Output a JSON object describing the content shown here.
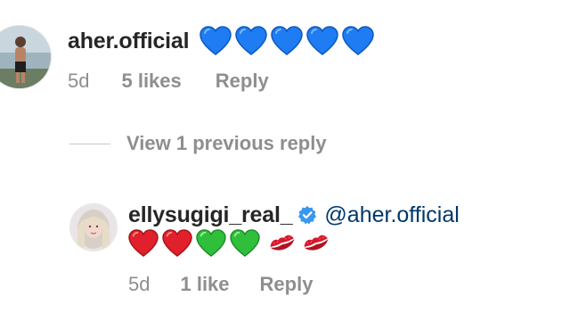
{
  "comments": [
    {
      "username": "aher.official",
      "text_emoji": [
        "blue-heart",
        "blue-heart",
        "blue-heart",
        "blue-heart",
        "blue-heart"
      ],
      "time": "5d",
      "likes": "5 likes",
      "reply_label": "Reply"
    }
  ],
  "thread": {
    "view_replies_label": "View 1 previous reply"
  },
  "reply": {
    "username": "ellysugigi_real_",
    "verified": true,
    "mention": "@aher.official",
    "text_emoji": [
      "red-heart",
      "red-heart",
      "green-heart",
      "green-heart",
      "kiss-mark",
      "kiss-mark"
    ],
    "time": "5d",
    "likes": "1 like",
    "reply_label": "Reply"
  },
  "colors": {
    "blue_heart": "#1f7cf2",
    "red_heart": "#e0202a",
    "green_heart": "#2fbf3a",
    "kiss_mark": "#d7192d",
    "verified_badge": "#3897f0",
    "mention": "#00376b",
    "meta_gray": "#8e8e8e"
  }
}
